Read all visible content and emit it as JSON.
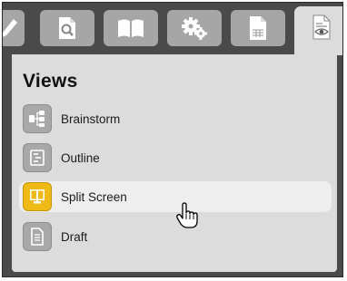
{
  "toolbar": {
    "tabs": [
      {
        "icon": "pencil-icon",
        "active": false
      },
      {
        "icon": "document-search-icon",
        "active": false
      },
      {
        "icon": "book-icon",
        "active": false
      },
      {
        "icon": "gears-icon",
        "active": false
      },
      {
        "icon": "document-table-icon",
        "active": false
      },
      {
        "icon": "document-eye-icon",
        "active": true
      }
    ]
  },
  "views_panel": {
    "title": "Views",
    "items": [
      {
        "label": "Brainstorm",
        "icon": "brainstorm-icon",
        "selected": false
      },
      {
        "label": "Outline",
        "icon": "outline-icon",
        "selected": false
      },
      {
        "label": "Split Screen",
        "icon": "split-screen-icon",
        "selected": true,
        "hovered": true
      },
      {
        "label": "Draft",
        "icon": "draft-icon",
        "selected": false
      }
    ]
  },
  "colors": {
    "background": "#4a4a4a",
    "panel": "#dcdcdc",
    "tab": "#a6a6a6",
    "selected_icon": "#f0ba16"
  }
}
